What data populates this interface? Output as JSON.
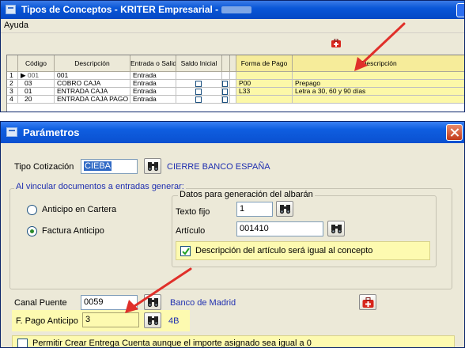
{
  "window1": {
    "title": "Tipos de Conceptos - KRITER Empresarial -",
    "menu": [
      "Ayuda"
    ],
    "table": {
      "columns": [
        "",
        "Código",
        "Descripción",
        "Entrada o Salida",
        "Saldo Inicial",
        "",
        "",
        "Forma de Pago",
        "Descripción"
      ],
      "rows": [
        {
          "num": "1",
          "indicator": "▶",
          "codigo": "001",
          "descripcion": "001",
          "entrada_salida": "Entrada",
          "forma_pago": "",
          "desc_fp": ""
        },
        {
          "num": "2",
          "indicator": "",
          "codigo": "03",
          "descripcion": "COBRO CAJA",
          "entrada_salida": "Entrada",
          "forma_pago": "P00",
          "desc_fp": "Prepago"
        },
        {
          "num": "3",
          "indicator": "",
          "codigo": "01",
          "descripcion": "ENTRADA CAJA",
          "entrada_salida": "Entrada",
          "forma_pago": "L33",
          "desc_fp": "Letra a 30, 60 y 90 días"
        },
        {
          "num": "4",
          "indicator": "",
          "codigo": "20",
          "descripcion": "ENTRADA CAJA PAGO ANTICIP",
          "entrada_salida": "Entrada",
          "forma_pago": "",
          "desc_fp": ""
        }
      ]
    }
  },
  "window2": {
    "title": "Parámetros",
    "tipo_cotizacion": {
      "label": "Tipo Cotización",
      "value": "CIEBA",
      "description": "CIERRE BANCO ESPAÑA"
    },
    "group_vincular": {
      "title": "Al vincular documentos a entradas generar:",
      "radio_anticipo_cartera": "Anticipo en Cartera",
      "radio_factura_anticipo": "Factura Anticipo",
      "selected": "Factura Anticipo"
    },
    "group_albaran": {
      "title": "Datos para generación del albarán",
      "texto_fijo": {
        "label": "Texto fijo",
        "value": "1"
      },
      "articulo": {
        "label": "Artículo",
        "value": "001410"
      },
      "checkbox_descripcion": {
        "label": "Descripción del artículo será igual al concepto",
        "checked": true
      }
    },
    "canal_puente": {
      "label": "Canal Puente",
      "value": "0059",
      "description": "Banco de Madrid"
    },
    "f_pago_anticipo": {
      "label": "F. Pago Anticipo",
      "value": "3",
      "description": "4B"
    },
    "checkbox_permitir": {
      "label": "Permitir Crear Entrega Cuenta aunque el importe asignado sea igual a 0",
      "checked": false
    }
  },
  "colors": {
    "highlight_yellow": "#fdfab0",
    "xp_title_blue": "#0a57d8",
    "annotation_arrow": "#e0302a",
    "link_blue": "#1f2fb0"
  }
}
